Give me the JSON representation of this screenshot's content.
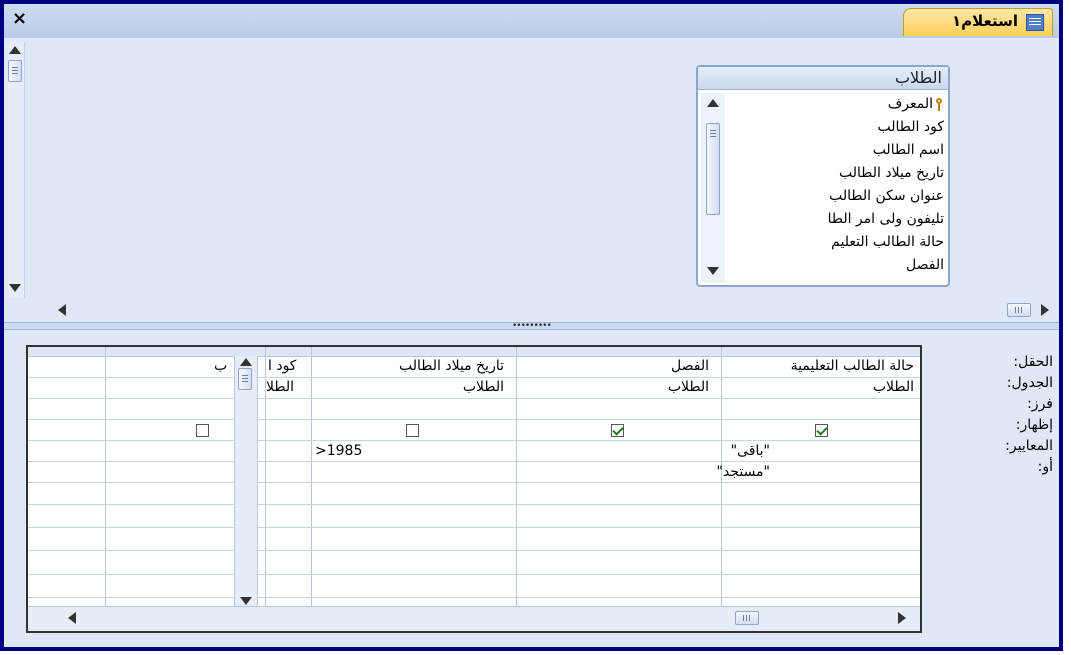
{
  "window": {
    "close_glyph": "×",
    "tab_label": "استعلام١",
    "tab_icon": "query-icon"
  },
  "table_box": {
    "title": "الطلاب",
    "fields": [
      "المعرف",
      "كود الطالب",
      "اسم الطالب",
      "تاريخ ميلاد الطالب",
      "عنوان سكن الطالب",
      "تليفون ولى امر الطا",
      "حالة الطالب التعليم",
      "الفصل"
    ]
  },
  "row_labels": [
    "الحقل:",
    "الجدول:",
    "فرز:",
    "إظهار:",
    "المعايير:",
    "أو:"
  ],
  "columns": [
    {
      "field": "حالة الطالب التعليمية",
      "table": "الطلاب",
      "show": true,
      "criteria": "\"باقى\"",
      "or": "\"مستجد\""
    },
    {
      "field": "الفصل",
      "table": "الطلاب",
      "show": true,
      "criteria": "",
      "or": ""
    },
    {
      "field": "تاريخ ميلاد الطالب",
      "table": "الطلاب",
      "show": false,
      "criteria": ">1985",
      "or": ""
    },
    {
      "field": "كود ا",
      "field_tail": "ب",
      "table": "الطلا",
      "show": false,
      "criteria": "",
      "or": ""
    }
  ],
  "colors": {
    "frame": "#000080",
    "background": "#dfe8f6",
    "tab": "#ffcf5a"
  }
}
